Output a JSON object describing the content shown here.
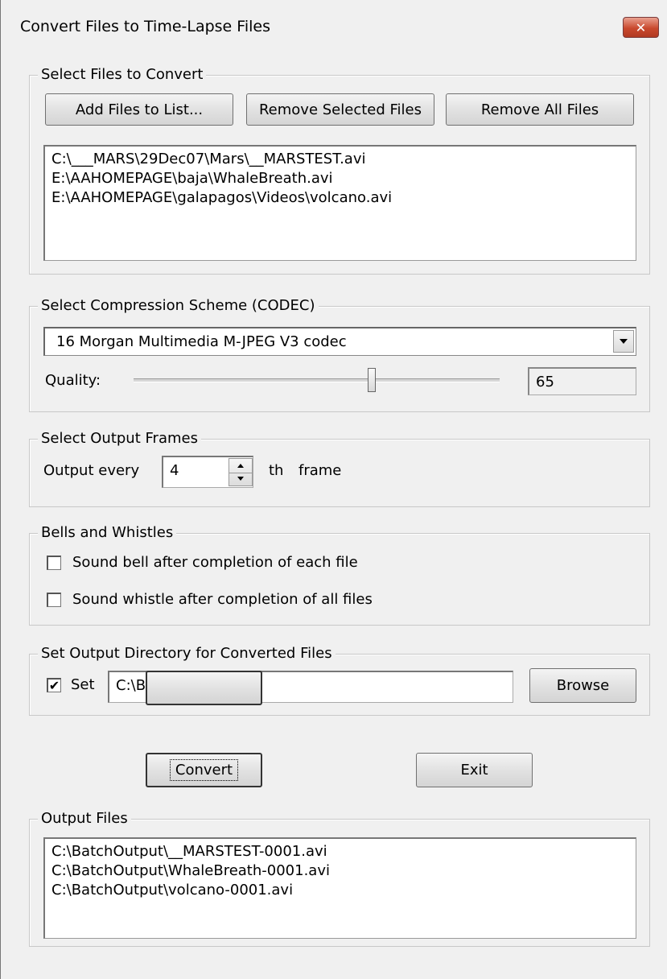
{
  "window": {
    "title": "Convert Files to Time-Lapse Files",
    "close_glyph": "✕"
  },
  "select_files": {
    "legend": "Select Files to Convert",
    "add_label": "Add Files to List...",
    "remove_selected_label": "Remove Selected Files",
    "remove_all_label": "Remove All Files",
    "files": [
      "C:\\___MARS\\29Dec07\\Mars\\__MARSTEST.avi",
      "E:\\AAHOMEPAGE\\baja\\WhaleBreath.avi",
      "E:\\AAHOMEPAGE\\galapagos\\Videos\\volcano.avi"
    ]
  },
  "codec": {
    "legend": "Select Compression Scheme (CODEC)",
    "selected": "16 Morgan Multimedia M-JPEG V3 codec",
    "quality_label": "Quality:",
    "quality_value": "65",
    "quality_fraction": 0.65
  },
  "frames": {
    "legend": "Select Output Frames",
    "prefix": "Output every",
    "value": "4",
    "suffix_th": "th",
    "suffix_frame": "frame"
  },
  "bells": {
    "legend": "Bells and Whistles",
    "bell_label": "Sound bell after completion of each file",
    "bell_checked": false,
    "whistle_label": "Sound whistle after completion of all files",
    "whistle_checked": false
  },
  "output_dir": {
    "legend": "Set Output Directory for Converted Files",
    "set_label": "Set",
    "set_checked": true,
    "check_glyph": "✔",
    "path": "C:\\BatchOutput\\",
    "browse_label": "Browse"
  },
  "actions": {
    "convert_label": "Convert",
    "exit_label": "Exit"
  },
  "output_files": {
    "legend": "Output Files",
    "files": [
      "C:\\BatchOutput\\__MARSTEST-0001.avi",
      "C:\\BatchOutput\\WhaleBreath-0001.avi",
      "C:\\BatchOutput\\volcano-0001.avi"
    ]
  }
}
